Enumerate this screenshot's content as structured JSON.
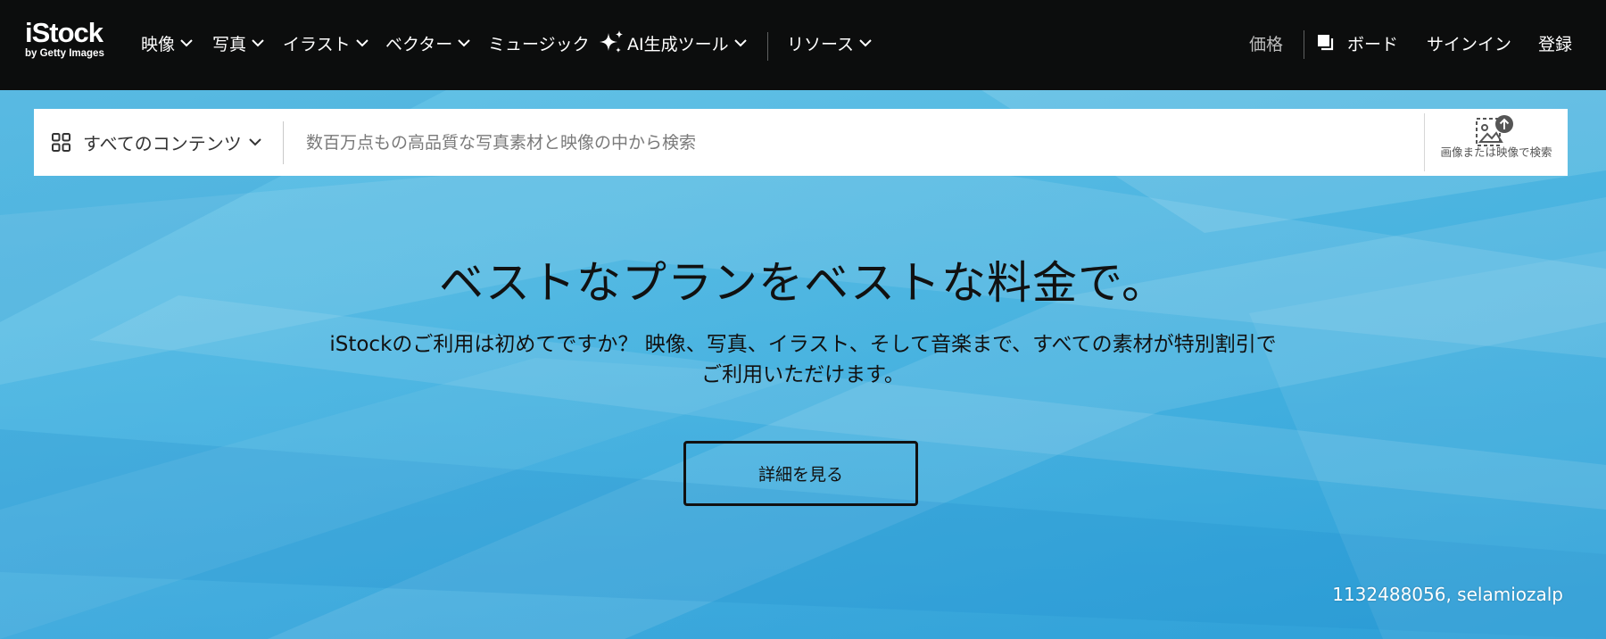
{
  "brand": {
    "name": "iStock",
    "tagline": "by Getty Images"
  },
  "nav": {
    "items": [
      {
        "label": "映像",
        "dropdown": true
      },
      {
        "label": "写真",
        "dropdown": true
      },
      {
        "label": "イラスト",
        "dropdown": true
      },
      {
        "label": "ベクター",
        "dropdown": true
      },
      {
        "label": "ミュージック",
        "dropdown": false
      },
      {
        "label": "AI生成ツール",
        "dropdown": true,
        "icon": "sparkle-icon"
      },
      {
        "label": "リソース",
        "dropdown": true
      }
    ],
    "right": {
      "pricing": "価格",
      "boards": "ボード",
      "signin": "サインイン",
      "register": "登録"
    }
  },
  "search": {
    "content_type": "すべてのコンテンツ",
    "placeholder": "数百万点もの高品質な写真素材と映像の中から検索",
    "value": "",
    "visual_search_label": "画像または映像で検索"
  },
  "hero": {
    "headline": "ベストなプランをベストな料金で。",
    "subtext": "iStockのご利用は初めてですか？ 映像、写真、イラスト、そして音楽まで、すべての素材が特別割引でご利用いただけます。",
    "cta_label": "詳細を見る",
    "image_credit": "1132488056, selamiozalp"
  },
  "colors": {
    "nav_bg": "#0c0d0d",
    "hero_blue": "#39acdc",
    "nav_text": "#ffffff",
    "nav_muted": "#bdbdbd"
  }
}
